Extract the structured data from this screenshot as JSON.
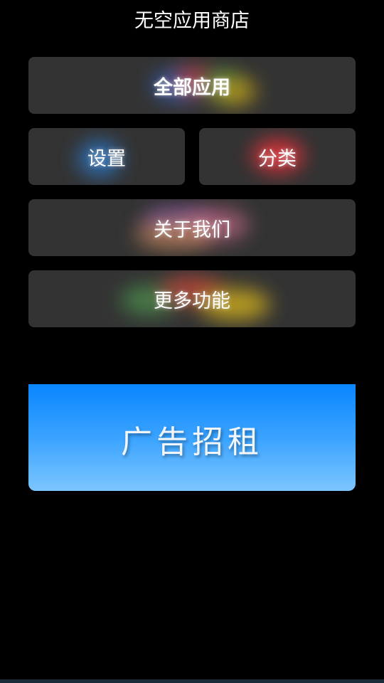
{
  "app": {
    "title": "无空应用商店"
  },
  "menu": {
    "all_apps": "全部应用",
    "settings": "设置",
    "category": "分类",
    "about_us": "关于我们",
    "more_features": "更多功能"
  },
  "ad_banner": {
    "text": "广告招租"
  },
  "colors": {
    "button_bg": "#333333",
    "background": "#000000",
    "ad_top": "#0a86ff",
    "ad_bottom": "#7cc6ff"
  }
}
